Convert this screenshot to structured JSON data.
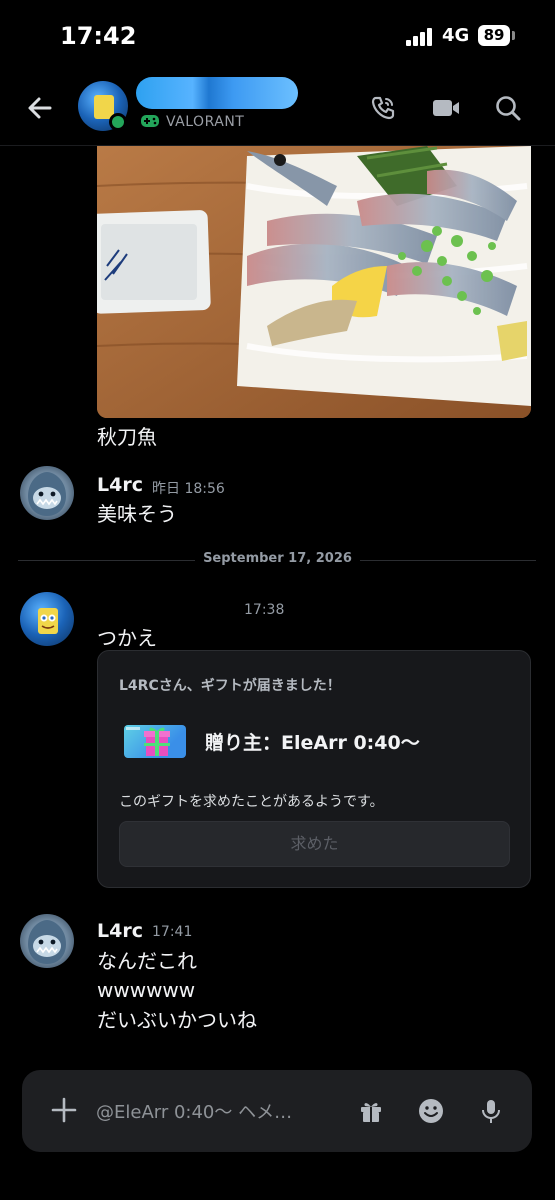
{
  "status_bar": {
    "time": "17:42",
    "network": "4G",
    "battery": "89"
  },
  "header": {
    "game": "VALORANT"
  },
  "messages": [
    {
      "text": "秋刀魚"
    },
    {
      "username": "L4rc",
      "timestamp": "昨日 18:56",
      "lines": [
        "美味そう"
      ]
    }
  ],
  "date_divider": "September 17, 2026",
  "gift_message": {
    "timestamp": "17:38",
    "text": "つかえ",
    "card": {
      "title": "L4RCさん、ギフトが届きました！",
      "from": "贈り主：EleArr 0:40〜",
      "description": "このギフトを求めたことがあるようです。",
      "button": "求めた"
    }
  },
  "last_group": {
    "username": "L4rc",
    "timestamp": "17:41",
    "lines": [
      "なんだこれ",
      "wwwwww",
      "だいぶいかついね"
    ]
  },
  "input": {
    "placeholder": "@EleArr 0:40〜 ヘメ…"
  },
  "colors": {
    "online": "#23a55a",
    "accent_name": "#2ea1f0",
    "gift_accent": "#e84fbf"
  }
}
